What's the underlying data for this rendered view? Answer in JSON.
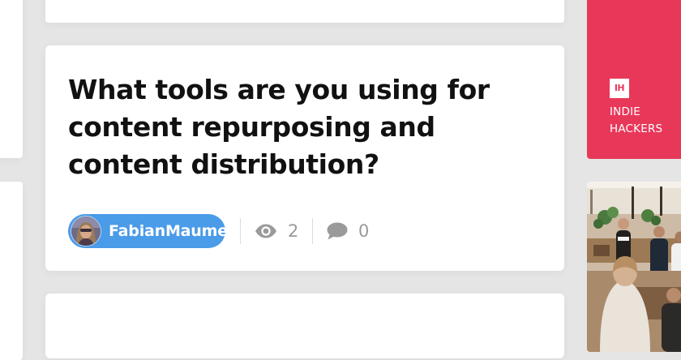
{
  "post": {
    "title": "What tools are you using for content repurposing and content distribution?",
    "author": "FabianMaume",
    "views": "2",
    "comments": "0"
  },
  "sidebar": {
    "ih_logo": "IH",
    "ih_name": "INDIE HACKERS"
  },
  "colors": {
    "background": "#e5e5e5",
    "card": "#ffffff",
    "author_pill": "#4a9be8",
    "ih_brand": "#e8385a",
    "stat_gray": "#9a9a9a"
  },
  "icons": {
    "views": "eye-icon",
    "comments": "speech-bubble-icon",
    "brand": "indie-hackers-logo"
  }
}
